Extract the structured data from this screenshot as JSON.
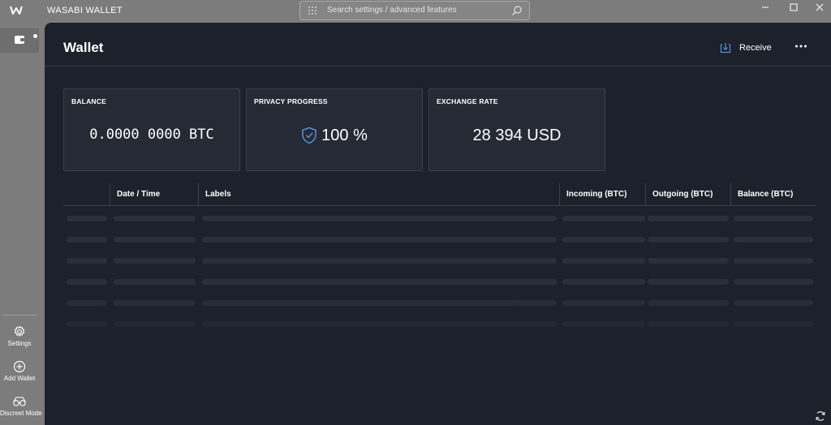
{
  "titlebar": {
    "app_title": "WASABI WALLET",
    "search_placeholder": "Search settings / advanced features"
  },
  "sidebar": {
    "items": [
      {
        "label": "Settings",
        "icon": "gear-icon"
      },
      {
        "label": "Add Wallet",
        "icon": "plus-circle-icon"
      },
      {
        "label": "Discreet Mode",
        "icon": "glasses-icon"
      }
    ]
  },
  "header": {
    "title": "Wallet",
    "receive_label": "Receive"
  },
  "tiles": {
    "balance": {
      "title": "BALANCE",
      "value": "0.0000 0000 BTC"
    },
    "privacy": {
      "title": "PRIVACY PROGRESS",
      "value": "100 %"
    },
    "exchange": {
      "title": "EXCHANGE RATE",
      "value": "28 394 USD"
    }
  },
  "table": {
    "columns": [
      "",
      "Date / Time",
      "Labels",
      "Incoming (BTC)",
      "Outgoing (BTC)",
      "Balance (BTC)"
    ]
  },
  "colors": {
    "accent": "#5b8fd1",
    "main_bg": "#1d212b",
    "chrome_bg": "#7c7c7c"
  }
}
